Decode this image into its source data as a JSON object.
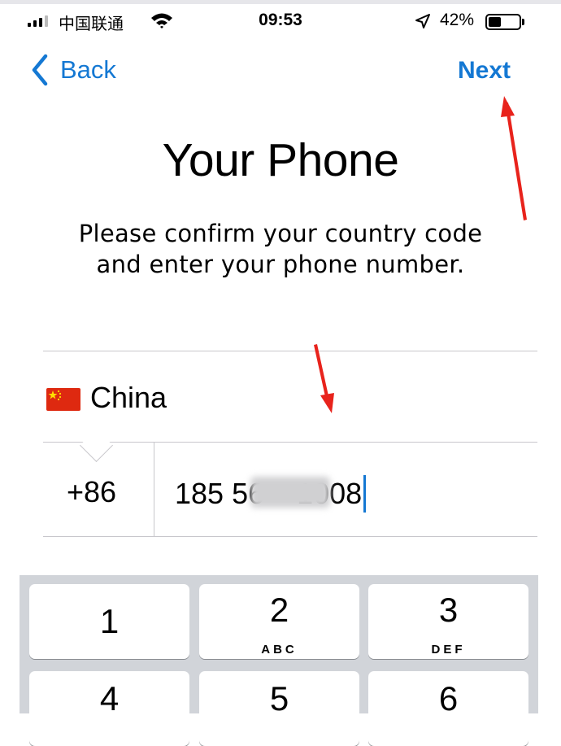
{
  "status_bar": {
    "carrier": "中国联通",
    "time": "09:53",
    "battery": "42%",
    "battery_level": 0.42
  },
  "nav": {
    "back_label": "Back",
    "next_label": "Next"
  },
  "title": "Your Phone",
  "subtitle": {
    "line1": "Please confirm your country code",
    "line2": "and enter your phone number."
  },
  "form": {
    "country": "China",
    "country_code": "+86",
    "phone_number": "185 56    1008"
  },
  "keypad": [
    {
      "digit": "1",
      "letters": ""
    },
    {
      "digit": "2",
      "letters": "ABC"
    },
    {
      "digit": "3",
      "letters": "DEF"
    },
    {
      "digit": "4",
      "letters": ""
    },
    {
      "digit": "5",
      "letters": ""
    },
    {
      "digit": "6",
      "letters": ""
    }
  ],
  "colors": {
    "accent": "#1478d3",
    "annotation": "#e8231c",
    "flag_red": "#de2910",
    "keypad_bg": "#d1d4d9"
  },
  "icons": [
    "signal-icon",
    "wifi-icon",
    "location-arrow-icon",
    "battery-icon",
    "chevron-left-icon",
    "china-flag-icon"
  ]
}
